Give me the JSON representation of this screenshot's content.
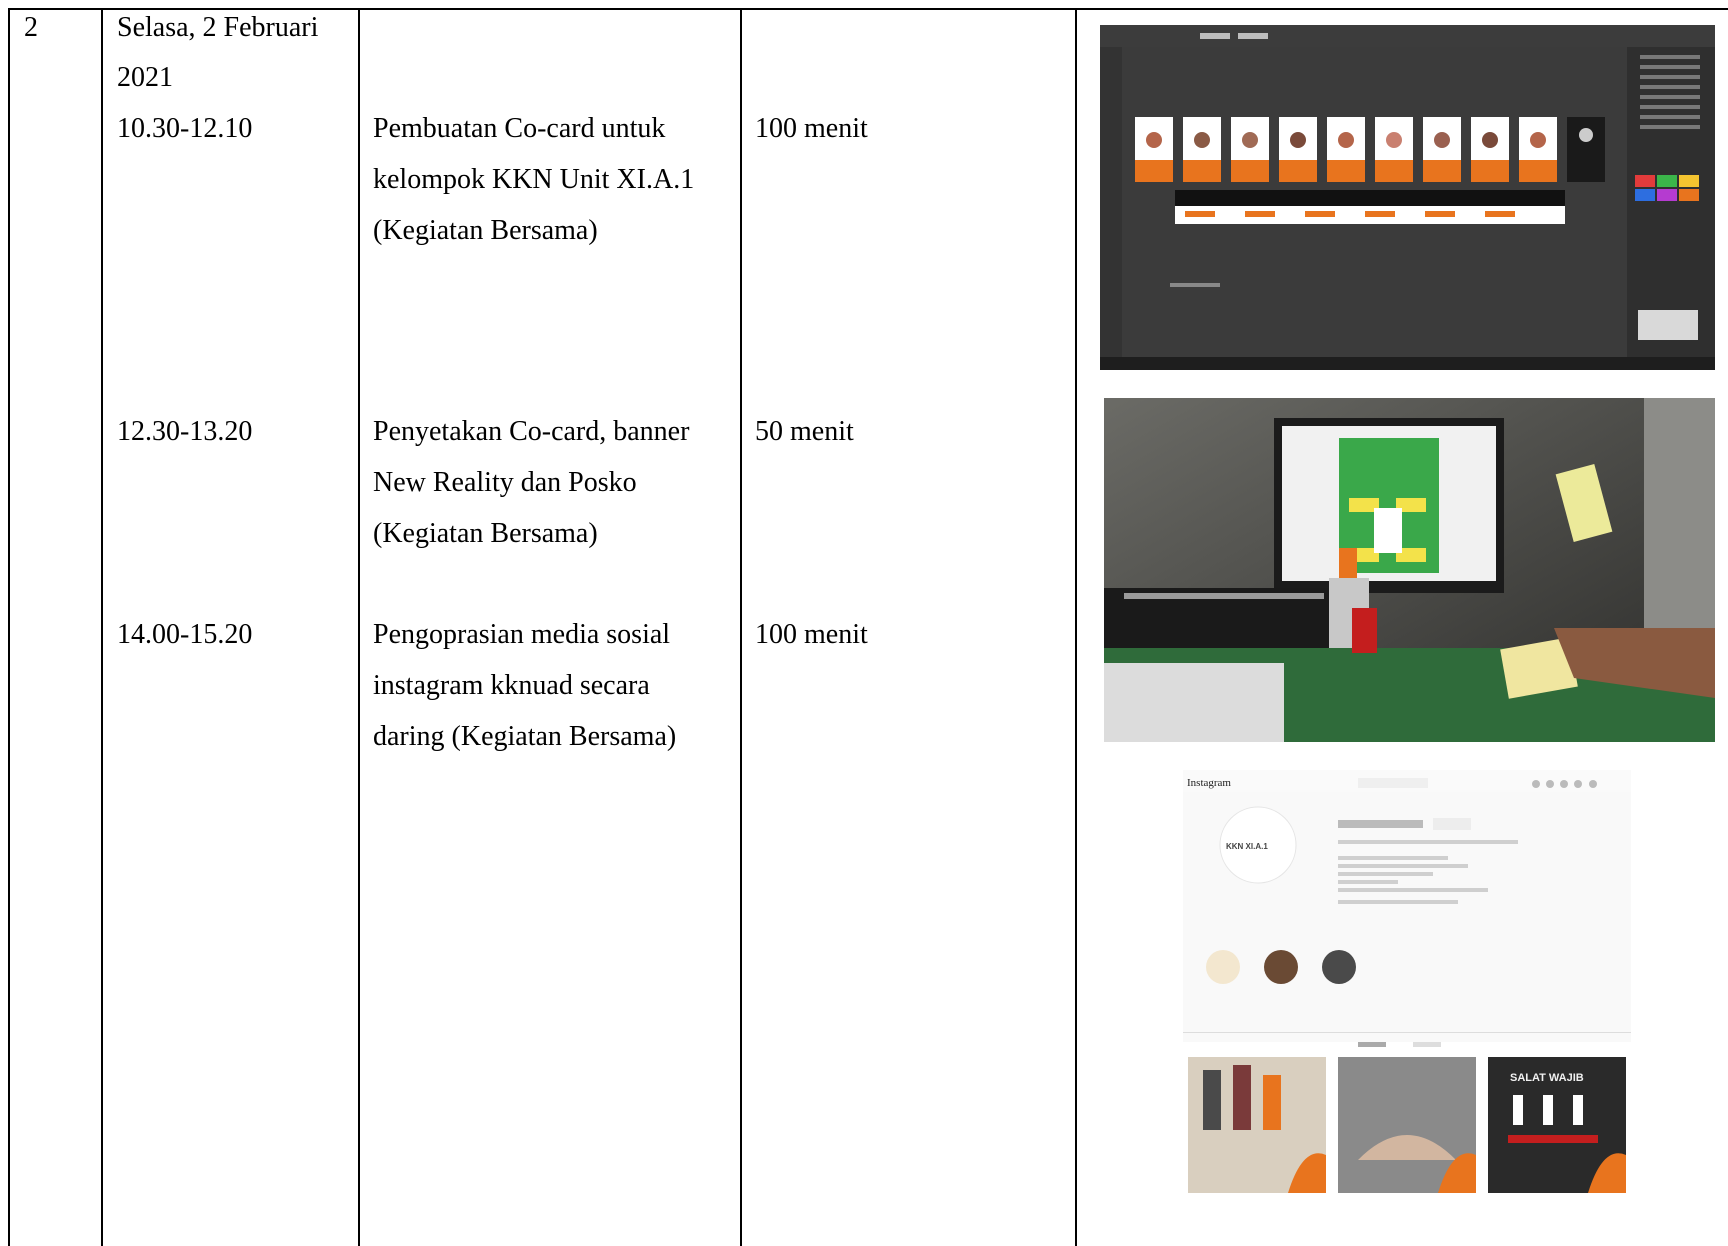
{
  "row": {
    "number": "2",
    "date_line1": "Selasa, 2 Februari",
    "date_line2": "2021",
    "activities": [
      {
        "time": "10.30-12.10",
        "desc": [
          "Pembuatan Co-card untuk",
          "kelompok KKN Unit XI.A.1",
          "(Kegiatan Bersama)"
        ],
        "duration": "100 menit"
      },
      {
        "time": "12.30-13.20",
        "desc": [
          "Penyetakan Co-card, banner",
          "New Reality dan Posko",
          "(Kegiatan Bersama)"
        ],
        "duration": "50 menit"
      },
      {
        "time": "14.00-15.20",
        "desc": [
          "Pengoprasian media sosial",
          "instagram kknuad secara",
          "daring (Kegiatan Bersama)"
        ],
        "duration": "100 menit"
      }
    ]
  },
  "photos": {
    "instagram": {
      "app_name": "Instagram",
      "logo_text": "KKN XI.A.1",
      "poster_text": "SALAT WAJIB"
    }
  },
  "colors": {
    "accent": "#e8741e",
    "editor_bg": "#3a3a3a",
    "screen_green": "#3aa84a"
  }
}
